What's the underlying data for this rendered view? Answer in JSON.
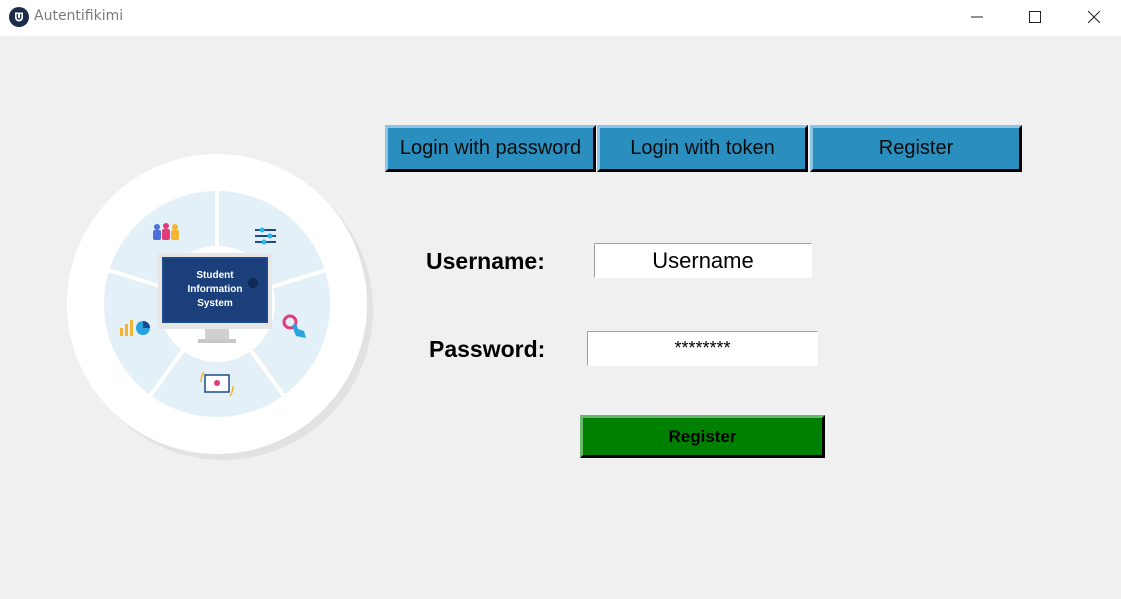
{
  "window": {
    "title": "Autentifikimi",
    "icon": "shield-icon"
  },
  "illustration": {
    "screen_text": [
      "Student",
      "Information",
      "System"
    ]
  },
  "tabs": [
    {
      "label": "Login with password"
    },
    {
      "label": "Login with token"
    },
    {
      "label": "Register"
    }
  ],
  "form": {
    "username_label": "Username:",
    "username_value": "Username",
    "password_label": "Password:",
    "password_value": "********",
    "submit_label": "Register"
  },
  "colors": {
    "tab_bg": "#2a8fbf",
    "submit_bg": "#008000",
    "background": "#f0f0f0"
  }
}
